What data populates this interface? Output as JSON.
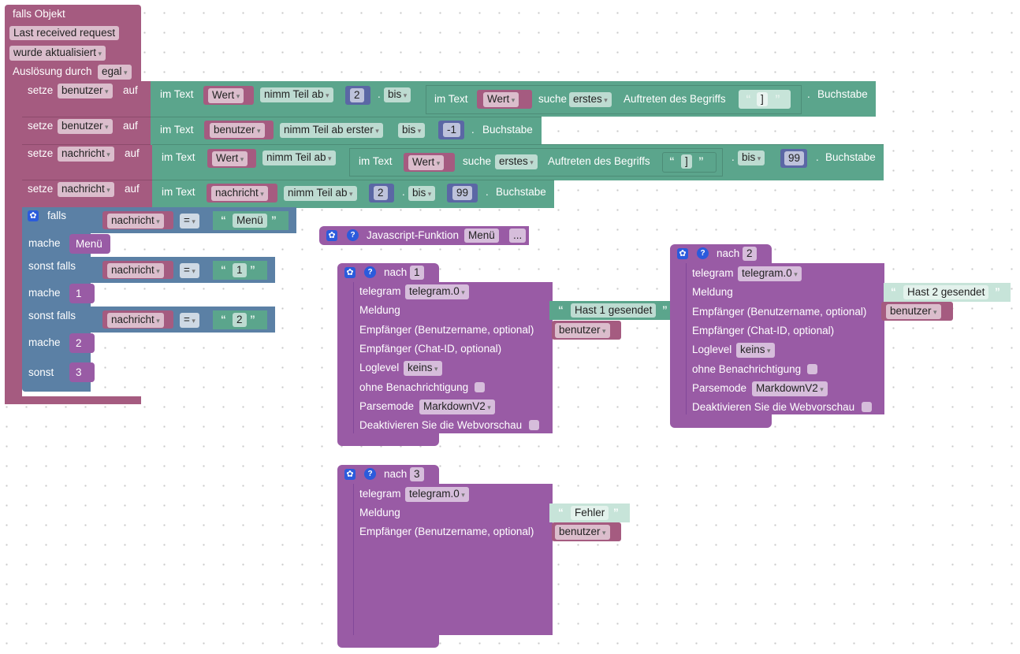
{
  "event": {
    "title": "falls Objekt",
    "object": "Last received request",
    "condition": "wurde aktualisiert",
    "trigger_label": "Auslösung durch",
    "trigger_value": "egal"
  },
  "set_label": "setze",
  "to_label": "auf",
  "in_text": "im Text",
  "dot": ".",
  "letter": "Buchstabe",
  "search": "suche",
  "occurrence": "Auftreten des Begriffs",
  "rows": [
    {
      "var": "benutzer",
      "src": "Wert",
      "op": "nimm Teil ab",
      "from": "2",
      "to_op": "bis",
      "inner": {
        "src": "Wert",
        "which": "erstes",
        "term": "]"
      }
    },
    {
      "var": "benutzer",
      "src": "benutzer",
      "op": "nimm Teil ab erster",
      "to_op": "bis",
      "to": "-1"
    },
    {
      "var": "nachricht",
      "src": "Wert",
      "op": "nimm Teil ab",
      "inner": {
        "src": "Wert",
        "which": "erstes",
        "term": "]"
      },
      "to_op": "bis",
      "to": "99"
    },
    {
      "var": "nachricht",
      "src": "nachricht",
      "op": "nimm Teil ab",
      "from": "2",
      "to_op": "bis",
      "to": "99"
    }
  ],
  "if_block": {
    "if": "falls",
    "elseif": "sonst falls",
    "do": "mache",
    "else": "sonst",
    "var": "nachricht",
    "eq": "=",
    "cases": [
      "Menü",
      "1",
      "2"
    ],
    "calls": [
      "Menü",
      "1",
      "2",
      "3"
    ]
  },
  "js_function": {
    "label": "Javascript-Funktion",
    "name": "Menü",
    "more": "..."
  },
  "quote_open": "“",
  "quote_close": "”",
  "nach_blocks": [
    {
      "label": "nach",
      "arg": "1",
      "message": "Hast 1 gesendet"
    },
    {
      "label": "nach",
      "arg": "2",
      "message": "Hast 2 gesendet"
    },
    {
      "label": "nach",
      "arg": "3",
      "message": "Fehler"
    }
  ],
  "telegram": {
    "telegram": "telegram.0",
    "telegram_label": "telegram",
    "message": "Meldung",
    "recipient_user": "Empfänger (Benutzername, optional)",
    "recipient_chat": "Empfänger (Chat-ID, optional)",
    "loglevel": "Loglevel",
    "loglevel_value": "keins",
    "silent": "ohne Benachrichtigung",
    "parsemode": "Parsemode",
    "parsemode_value": "MarkdownV2",
    "no_preview": "Deaktivieren Sie die Webvorschau",
    "user_var": "benutzer"
  }
}
